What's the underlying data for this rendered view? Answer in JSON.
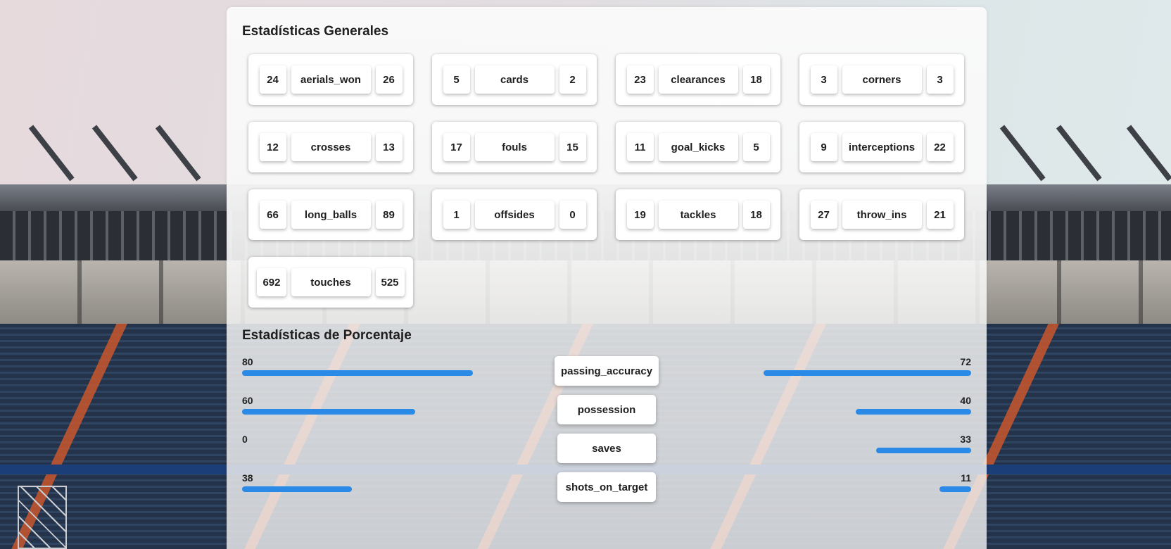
{
  "general": {
    "title": "Estadísticas Generales",
    "stats": [
      {
        "label": "aerials_won",
        "home": "24",
        "away": "26"
      },
      {
        "label": "cards",
        "home": "5",
        "away": "2"
      },
      {
        "label": "clearances",
        "home": "23",
        "away": "18"
      },
      {
        "label": "corners",
        "home": "3",
        "away": "3"
      },
      {
        "label": "crosses",
        "home": "12",
        "away": "13"
      },
      {
        "label": "fouls",
        "home": "17",
        "away": "15"
      },
      {
        "label": "goal_kicks",
        "home": "11",
        "away": "5"
      },
      {
        "label": "interceptions",
        "home": "9",
        "away": "22"
      },
      {
        "label": "long_balls",
        "home": "66",
        "away": "89"
      },
      {
        "label": "offsides",
        "home": "1",
        "away": "0"
      },
      {
        "label": "tackles",
        "home": "19",
        "away": "18"
      },
      {
        "label": "throw_ins",
        "home": "27",
        "away": "21"
      },
      {
        "label": "touches",
        "home": "692",
        "away": "525"
      }
    ]
  },
  "percentage": {
    "title": "Estadísticas de Porcentaje",
    "bar_color": "#2a8ae6",
    "stats": [
      {
        "label": "passing_accuracy",
        "home": 80,
        "away": 72
      },
      {
        "label": "possession",
        "home": 60,
        "away": 40
      },
      {
        "label": "saves",
        "home": 0,
        "away": 33
      },
      {
        "label": "shots_on_target",
        "home": 38,
        "away": 11
      }
    ]
  }
}
